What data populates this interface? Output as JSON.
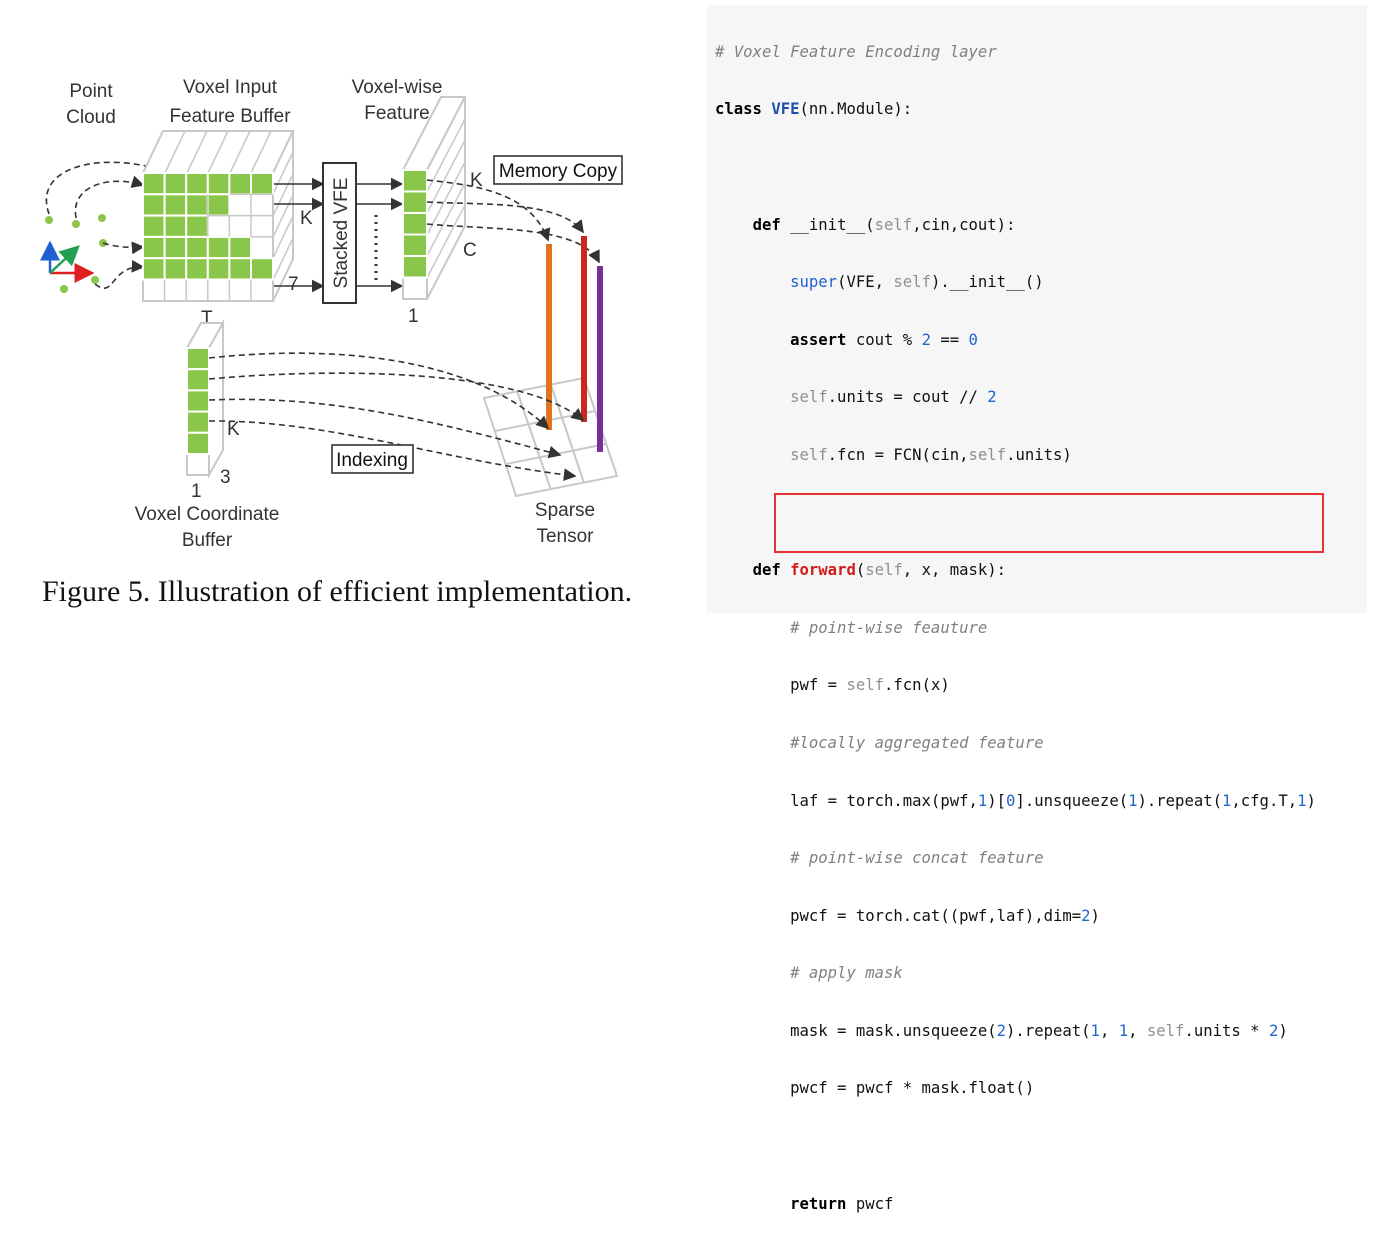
{
  "figure": {
    "labels": {
      "point_cloud_line1": "Point",
      "point_cloud_line2": "Cloud",
      "voxel_input_line1": "Voxel Input",
      "voxel_input_line2": "Feature  Buffer",
      "voxel_wise_line1": "Voxel-wise",
      "voxel_wise_line2": "Feature",
      "memory_copy": "Memory Copy",
      "stacked_vfe": "Stacked VFE",
      "k_buffer": "K",
      "k_feature": "K",
      "k_coord": "K",
      "c_dim": "C",
      "t_dim": "T",
      "seven": "7",
      "one_feature": "1",
      "one_coord": "1",
      "three_coord": "3",
      "indexing": "Indexing",
      "voxel_coord_line1": "Voxel Coordinate",
      "voxel_coord_line2": "Buffer",
      "sparse_line1": "Sparse",
      "sparse_line2": "Tensor"
    },
    "caption": "Figure 5. Illustration of efficient implementation.",
    "colors": {
      "cell_fill": "#8ac64a",
      "grid_line": "#c8c8c8",
      "arrow": "#333333",
      "bar_orange": "#e07420",
      "bar_red": "#c8281e",
      "bar_purple": "#7a2e9a",
      "axis_red": "#e02020",
      "axis_green": "#20a050",
      "axis_blue": "#2060d0"
    },
    "icons": [
      "coordinate-axes-icon"
    ]
  },
  "code": {
    "lines": {
      "l0": "# Voxel Feature Encoding layer",
      "l1_kw": "class",
      "l1_name": "VFE",
      "l1_rest": "(nn.Module):",
      "l3_kw": "def",
      "l3_name": "__init__(",
      "l3_self": "self",
      "l3_rest": ",cin,cout):",
      "l4_super": "super",
      "l4_a": "(VFE, ",
      "l4_self": "self",
      "l4_b": ").__init__()",
      "l5_kw": "assert",
      "l5_a": " cout % ",
      "l5_n1": "2",
      "l5_b": " == ",
      "l5_n2": "0",
      "l6_self": "self",
      "l6_a": ".units = cout // ",
      "l6_n": "2",
      "l7_self": "self",
      "l7_a": ".fcn = FCN(cin,",
      "l7_self2": "self",
      "l7_b": ".units)",
      "l9_kw": "def",
      "l9_name": "forward",
      "l9_a": "(",
      "l9_self": "self",
      "l9_b": ", x, mask):",
      "l10": "# point-wise feauture",
      "l11_a": "pwf = ",
      "l11_self": "self",
      "l11_b": ".fcn(x)",
      "l12": "#locally aggregated feature",
      "l13_a": "laf = torch.max(pwf,",
      "l13_n1": "1",
      "l13_b": ")[",
      "l13_n2": "0",
      "l13_c": "].unsqueeze(",
      "l13_n3": "1",
      "l13_d": ").repeat(",
      "l13_n4": "1",
      "l13_e": ",cfg.T,",
      "l13_n5": "1",
      "l13_f": ")",
      "l14": "# point-wise concat feature",
      "l15_a": "pwcf = torch.cat((pwf,laf),dim=",
      "l15_n": "2",
      "l15_b": ")",
      "l16": "# apply mask",
      "l17_a": "mask = mask.unsqueeze(",
      "l17_n1": "2",
      "l17_b": ").repeat(",
      "l17_n2": "1",
      "l17_c": ", ",
      "l17_n3": "1",
      "l17_d": ", ",
      "l17_self": "self",
      "l17_e": ".units * ",
      "l17_n4": "2",
      "l17_f": ")",
      "l18": "pwcf = pwcf * mask.float()",
      "l20_kw": "return",
      "l20_a": " pwcf"
    },
    "highlight_color": "#e53232"
  }
}
